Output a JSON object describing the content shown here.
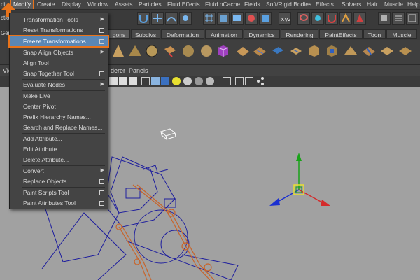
{
  "menubar": {
    "items": [
      "dit",
      "Modify",
      "Create",
      "Display",
      "Window",
      "Assets",
      "Particles",
      "Fluid Effects",
      "Fluid nCache",
      "Fields",
      "Soft/Rigid Bodies",
      "Effects",
      "Solvers",
      "Hair",
      "Muscle",
      "Help"
    ]
  },
  "left_labels": {
    "mode": "ctio",
    "shelf": "Ger",
    "view": "Vie",
    "renderer": "derer",
    "panels": "Panels"
  },
  "tabs": [
    "gons",
    "Subdivs",
    "Deformation",
    "Animation",
    "Dynamics",
    "Rendering",
    "PaintEffects",
    "Toon",
    "Muscle"
  ],
  "modify_menu": {
    "items": [
      {
        "label": "Transformation Tools",
        "indicator": "submenu"
      },
      {
        "label": "Reset Transformations",
        "indicator": "option"
      },
      {
        "label": "Freeze Transformations",
        "indicator": "option",
        "highlighted": true
      },
      {
        "label": "Snap Align Objects",
        "indicator": "submenu"
      },
      {
        "label": "Align Tool",
        "indicator": "none"
      },
      {
        "label": "Snap Together Tool",
        "indicator": "option"
      },
      {
        "label": "Evaluate Nodes",
        "indicator": "submenu"
      },
      {
        "label": "Make Live",
        "indicator": "none"
      },
      {
        "label": "Center Pivot",
        "indicator": "none"
      },
      {
        "label": "Prefix Hierarchy Names...",
        "indicator": "none"
      },
      {
        "label": "Search and Replace Names...",
        "indicator": "none"
      },
      {
        "label": "Add Attribute...",
        "indicator": "none"
      },
      {
        "label": "Edit Attribute...",
        "indicator": "none"
      },
      {
        "label": "Delete Attribute...",
        "indicator": "none"
      },
      {
        "label": "Convert",
        "indicator": "submenu"
      },
      {
        "label": "Replace Objects",
        "indicator": "option"
      },
      {
        "label": "Paint Scripts Tool",
        "indicator": "option"
      },
      {
        "label": "Paint Attributes Tool",
        "indicator": "option"
      }
    ]
  },
  "colors": {
    "accent_orange": "#e8731a",
    "highlight_blue": "#5a87b5",
    "viewport_bg": "#a1a1a1",
    "axis_x": "#d42a2a",
    "axis_y": "#19a319",
    "axis_z": "#1a2fd1",
    "wire_blue": "#1e1e9e",
    "wire_orange": "#c8642a"
  }
}
